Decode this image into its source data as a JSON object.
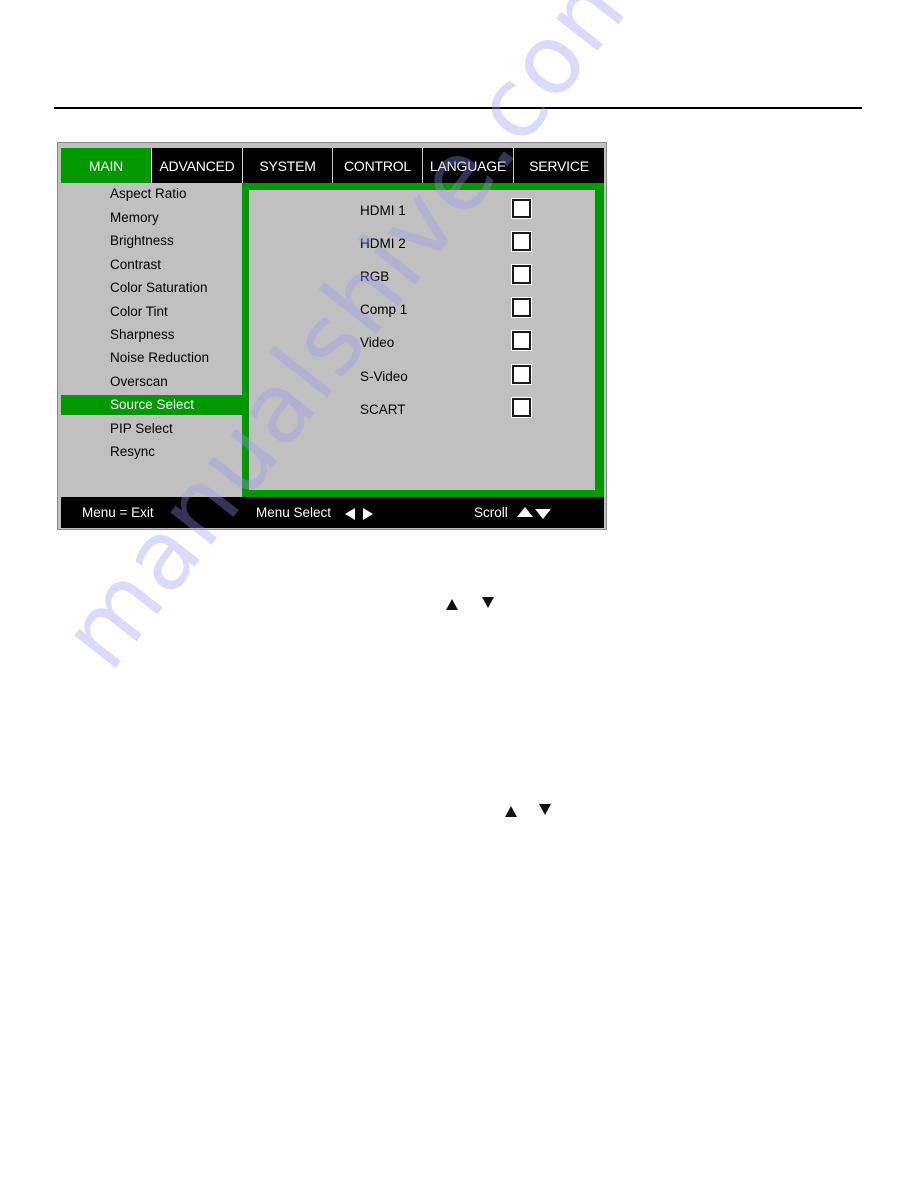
{
  "osd": {
    "tabs": [
      {
        "label": "MAIN",
        "active": true
      },
      {
        "label": "ADVANCED",
        "active": false
      },
      {
        "label": "SYSTEM",
        "active": false
      },
      {
        "label": "CONTROL",
        "active": false
      },
      {
        "label": "LANGUAGE",
        "active": false
      },
      {
        "label": "SERVICE",
        "active": false
      }
    ],
    "menu_items": [
      {
        "label": "Aspect Ratio"
      },
      {
        "label": "Memory"
      },
      {
        "label": "Brightness"
      },
      {
        "label": "Contrast"
      },
      {
        "label": "Color Saturation"
      },
      {
        "label": "Color Tint"
      },
      {
        "label": "Sharpness"
      },
      {
        "label": "Noise Reduction"
      },
      {
        "label": "Overscan"
      },
      {
        "label": "Source Select",
        "selected": true
      },
      {
        "label": "PIP Select"
      },
      {
        "label": "Resync"
      }
    ],
    "source_options": [
      {
        "label": "HDMI 1",
        "checked": false
      },
      {
        "label": "HDMI 2",
        "checked": false
      },
      {
        "label": "RGB",
        "checked": false
      },
      {
        "label": "Comp 1",
        "checked": false
      },
      {
        "label": "Video",
        "checked": false
      },
      {
        "label": "S-Video",
        "checked": false
      },
      {
        "label": "SCART",
        "checked": false
      }
    ],
    "bottom_bar": {
      "exit_hint": "Menu = Exit",
      "menu_select_hint": "Menu Select",
      "scroll_hint": "Scroll"
    },
    "colors": {
      "accent_green": "#009900",
      "panel_gray": "#c0c0c0",
      "bar_black": "#000000"
    }
  },
  "page_icons": [
    {
      "name": "up-arrow-icon",
      "glyph": "▲"
    },
    {
      "name": "down-arrow-icon",
      "glyph": "▼"
    },
    {
      "name": "up-arrow-icon",
      "glyph": "▲"
    },
    {
      "name": "down-arrow-icon",
      "glyph": "▼"
    }
  ],
  "watermark": "manualshive.com"
}
